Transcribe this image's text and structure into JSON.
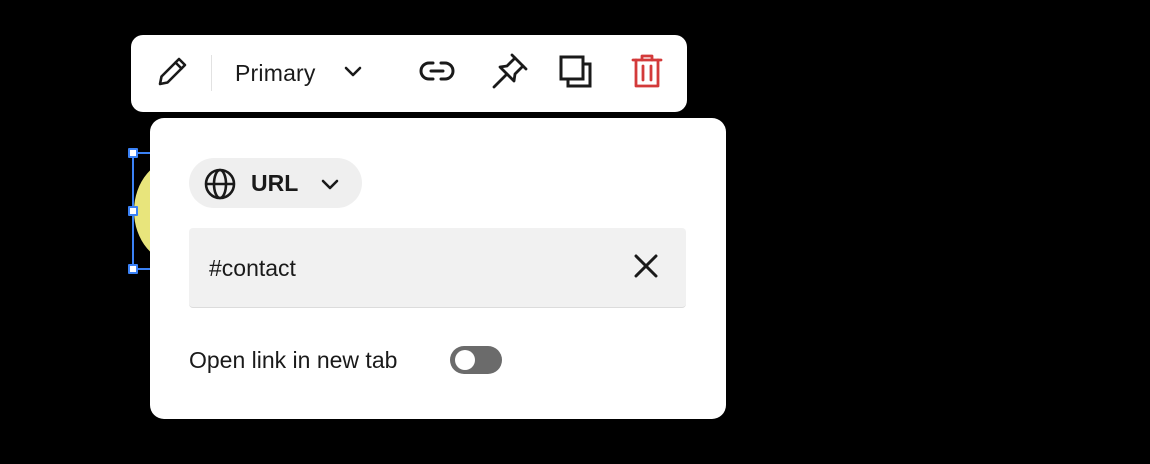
{
  "toolbar": {
    "edit_icon": "pencil-icon",
    "variant_label": "Primary",
    "variant_chevron_icon": "chevron-down-icon",
    "link_icon": "link-icon",
    "pin_icon": "pin-icon",
    "duplicate_icon": "duplicate-icon",
    "delete_icon": "trash-icon",
    "delete_color": "#d33a3a"
  },
  "link_popover": {
    "link_type": {
      "icon": "globe-icon",
      "label": "URL",
      "chevron_icon": "chevron-down-icon"
    },
    "url_field": {
      "value": "#contact",
      "clear_icon": "close-icon"
    },
    "new_tab": {
      "label": "Open link in new tab",
      "enabled": false
    }
  },
  "selection": {
    "accent_color": "#3b82f6",
    "shape_fill": "#e8e57c"
  }
}
